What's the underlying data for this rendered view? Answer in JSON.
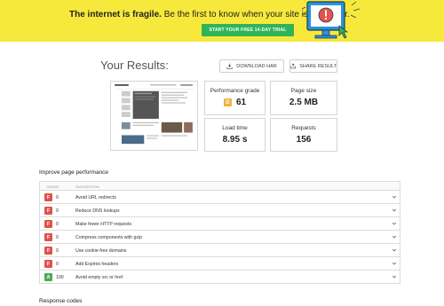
{
  "banner": {
    "headline_bold": "The internet is fragile.",
    "headline_rest": " Be the first to know when your site is in danger.",
    "cta": "START YOUR FREE 14-DAY TRIAL",
    "colors": {
      "background": "#f7e93c",
      "cta": "#2fb457",
      "alert": "#e8524a",
      "screen": "#2c93d8"
    },
    "illustration_icon": "monitor-alert-icon"
  },
  "results": {
    "title": "Your Results:",
    "download_label": "DOWNLOAD HAR",
    "share_label": "SHARE RESULT",
    "download_icon": "download-icon",
    "share_icon": "share-icon"
  },
  "metrics": {
    "performance": {
      "label": "Performance grade",
      "grade": "D",
      "value": "61",
      "grade_color": "#f2b23e"
    },
    "page_size": {
      "label": "Page size",
      "value": "2.5 MB"
    },
    "load_time": {
      "label": "Load time",
      "value": "8.95 s"
    },
    "requests": {
      "label": "Requests",
      "value": "156"
    }
  },
  "improve": {
    "title": "Improve page performance",
    "columns": {
      "grade": "GRADE",
      "suggestion": "SUGGESTION"
    },
    "rows": [
      {
        "grade": "F",
        "score": "0",
        "suggestion": "Avoid URL redirects",
        "color": "#e0524a"
      },
      {
        "grade": "F",
        "score": "0",
        "suggestion": "Reduce DNS lookups",
        "color": "#e0524a"
      },
      {
        "grade": "F",
        "score": "0",
        "suggestion": "Make fewer HTTP requests",
        "color": "#e0524a"
      },
      {
        "grade": "F",
        "score": "0",
        "suggestion": "Compress components with gzip",
        "color": "#e0524a"
      },
      {
        "grade": "F",
        "score": "0",
        "suggestion": "Use cookie-free domains",
        "color": "#e0524a"
      },
      {
        "grade": "F",
        "score": "0",
        "suggestion": "Add Expires headers",
        "color": "#e0524a"
      },
      {
        "grade": "A",
        "score": "100",
        "suggestion": "Avoid empty src or href",
        "color": "#4dab4f"
      }
    ]
  },
  "response": {
    "title": "Response codes"
  }
}
